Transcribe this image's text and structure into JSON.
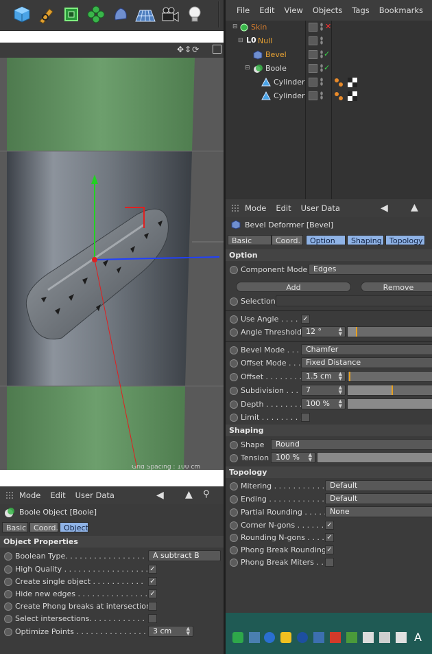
{
  "object_manager": {
    "menu": [
      "File",
      "Edit",
      "View",
      "Objects",
      "Tags",
      "Bookmarks"
    ],
    "objects": [
      {
        "name": "Skin",
        "color": "#d07a2e",
        "status": "x"
      },
      {
        "name": "Null",
        "color": "#e8a233",
        "status": ""
      },
      {
        "name": "Bevel",
        "color": "#e8a233",
        "status": "check"
      },
      {
        "name": "Boole",
        "color": "#dcdcdc",
        "status": "check"
      },
      {
        "name": "Cylinder",
        "color": "#dcdcdc",
        "status": ""
      },
      {
        "name": "Cylinder",
        "color": "#dcdcdc",
        "status": ""
      }
    ]
  },
  "bevel_attr": {
    "menu": [
      "Mode",
      "Edit",
      "User Data"
    ],
    "title": "Bevel Deformer [Bevel]",
    "tabs": [
      "Basic",
      "Coord.",
      "Option",
      "Shaping",
      "Topology"
    ],
    "section_option": "Option",
    "component_mode_label": "Component Mode",
    "component_mode_value": "Edges",
    "add_label": "Add",
    "remove_label": "Remove",
    "selection_label": "Selection",
    "use_angle_label": "Use Angle . . . . .",
    "angle_threshold_label": "Angle Threshold",
    "angle_threshold_value": "12 °",
    "bevel_mode_label": "Bevel Mode . . . .",
    "bevel_mode_value": "Chamfer",
    "offset_mode_label": "Offset Mode . . .",
    "offset_mode_value": "Fixed Distance",
    "offset_label": "Offset . . . . . . . . .",
    "offset_value": "1.5 cm",
    "subdivision_label": "Subdivision . . . .",
    "subdivision_value": "7",
    "depth_label": "Depth . . . . . . . .",
    "depth_value": "100 %",
    "limit_label": "Limit . . . . . . . . .",
    "section_shaping": "Shaping",
    "shape_label": "Shape",
    "shape_value": "Round",
    "tension_label": "Tension",
    "tension_value": "100 %",
    "section_topology": "Topology",
    "mitering_label": "Mitering . . . . . . . . . . . .",
    "mitering_value": "Default",
    "ending_label": "Ending . . . . . . . . . . . . . .",
    "ending_value": "Default",
    "partial_rounding_label": "Partial Rounding . . . . .",
    "partial_rounding_value": "None",
    "corner_ngons_label": "Corner N-gons . . . . . . .",
    "rounding_ngons_label": "Rounding N-gons . . . . .",
    "phong_break_rounding_label": "Phong Break Rounding",
    "phong_break_miters_label": "Phong Break Miters . . ."
  },
  "boole_attr": {
    "menu": [
      "Mode",
      "Edit",
      "User Data"
    ],
    "title": "Boole Object [Boole]",
    "tabs": [
      "Basic",
      "Coord.",
      "Object"
    ],
    "section": "Object Properties",
    "boolean_type_label": "Boolean Type. . . . . . . . . . . . . . . . .",
    "boolean_type_value": "A subtract B",
    "high_quality_label": "High Quality . . . . . . . . . . . . . . . . . . .",
    "create_single_label": "Create single object . . . . . . . . . . .",
    "hide_edges_label": "Hide new edges . . . . . . . . . . . . . . .",
    "create_phong_label": "Create Phong breaks at intersections",
    "select_intersections_label": "Select intersections. . . . . . . . . . . .",
    "optimize_points_label": "Optimize Points . . . . . . . . . . . . . . .",
    "optimize_points_value": "3 cm"
  },
  "viewport": {
    "grid_label": "Grid Spacing : 100 cm"
  },
  "colors": {
    "accent_tab": "#8fb3e6",
    "orange_marker": "#e6a020",
    "green_axis": "#22d122",
    "blue_axis": "#2040ff",
    "red_axis": "#e02020"
  }
}
